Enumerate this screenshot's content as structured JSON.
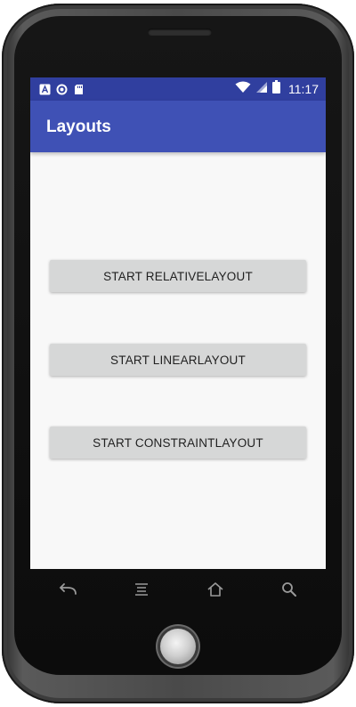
{
  "status_bar": {
    "time": "11:17",
    "left_icons": [
      "app-notification-icon",
      "sync-icon",
      "sd-card-icon"
    ],
    "right_icons": [
      "wifi-icon",
      "signal-icon",
      "battery-icon"
    ],
    "background_color": "#303f9f"
  },
  "app_bar": {
    "title": "Layouts",
    "background_color": "#3f51b5"
  },
  "buttons": {
    "relative": "START RELATIVELAYOUT",
    "linear": "START LINEARLAYOUT",
    "constraint": "START CONSTRAINTLAYOUT"
  },
  "nav_bar": {
    "icons": [
      "back-icon",
      "menu-icon",
      "home-icon",
      "search-icon"
    ]
  }
}
